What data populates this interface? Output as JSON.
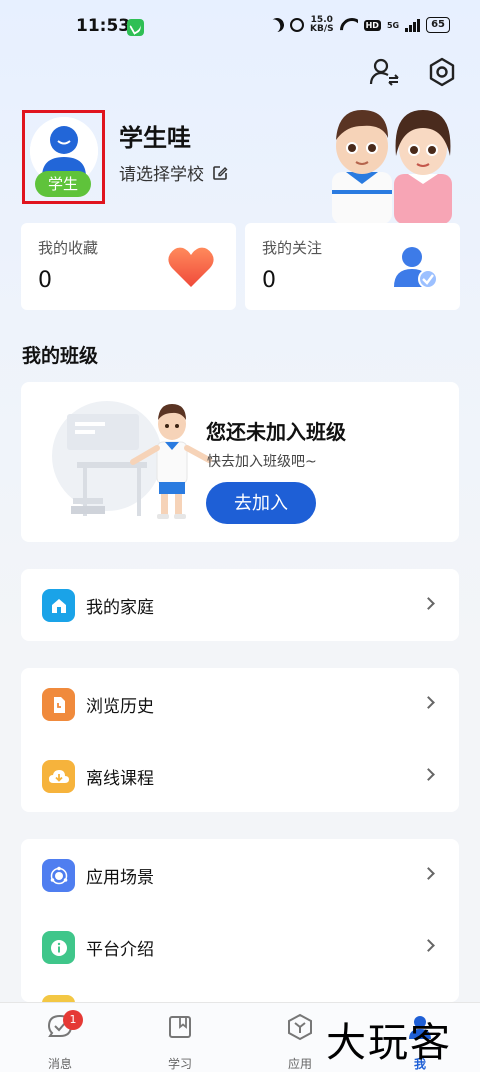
{
  "status_bar": {
    "time": "11:53",
    "net_speed_value": "15.0",
    "net_speed_unit": "KB/S",
    "hd": "HD",
    "signal": "5G",
    "battery": "65"
  },
  "profile": {
    "role_tag": "学生",
    "name": "学生哇",
    "school_prompt": "请选择学校"
  },
  "stats": [
    {
      "label": "我的收藏",
      "value": "0",
      "icon": "heart-icon"
    },
    {
      "label": "我的关注",
      "value": "0",
      "icon": "person-check-icon"
    }
  ],
  "class_section": {
    "title": "我的班级",
    "empty_title": "您还未加入班级",
    "empty_subtitle": "快去加入班级吧~",
    "join_label": "去加入"
  },
  "menu_groups": [
    [
      {
        "label": "我的家庭",
        "icon": "home-icon",
        "color": "#1aa3e8"
      }
    ],
    [
      {
        "label": "浏览历史",
        "icon": "history-icon",
        "color": "#f08a3c"
      },
      {
        "label": "离线课程",
        "icon": "download-icon",
        "color": "#f6b33c"
      }
    ],
    [
      {
        "label": "应用场景",
        "icon": "scene-icon",
        "color": "#4f7ef0"
      },
      {
        "label": "平台介绍",
        "icon": "info-icon",
        "color": "#3fc68a"
      }
    ]
  ],
  "bottom_nav": [
    {
      "label": "消息",
      "icon": "message-icon",
      "badge": "1"
    },
    {
      "label": "学习",
      "icon": "book-icon"
    },
    {
      "label": "应用",
      "icon": "apps-icon"
    },
    {
      "label": "我",
      "icon": "me-icon",
      "active": true
    }
  ],
  "watermark": "大玩客",
  "colors": {
    "primary": "#1e5fd6",
    "tag_green": "#5fc33b",
    "badge_red": "#e53935"
  }
}
